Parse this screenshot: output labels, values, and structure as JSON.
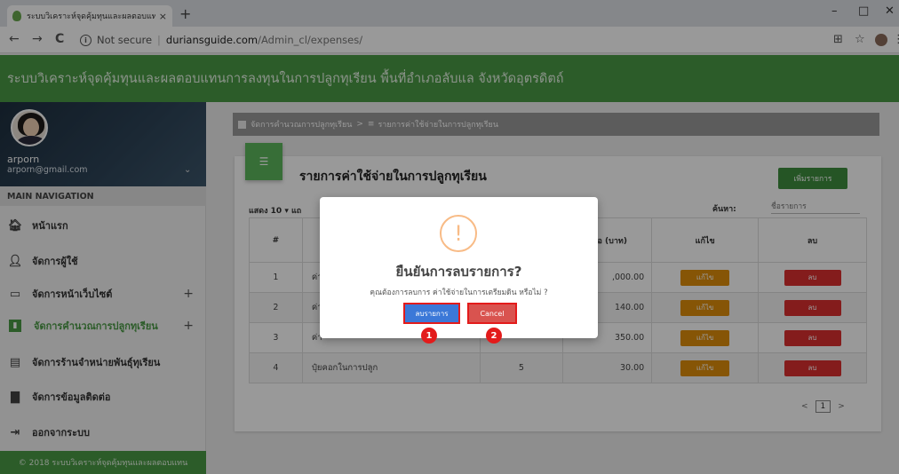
{
  "browser": {
    "tab_title": "ระบบวิเคราะห์จุดคุ้มทุนและผลตอบแทนก",
    "tab_close": "×",
    "new_tab": "+",
    "back": "←",
    "forward": "→",
    "reload": "C",
    "security_label": "Not secure",
    "host": "duriansguide.com",
    "path": "/Admin_cl/expenses/",
    "minimize": "–",
    "maximize": "□",
    "close": "✕"
  },
  "app": {
    "title": "ระบบวิเคราะห์จุดคุ้มทุนและผลตอบแทนการลงทุนในการปลูกทุเรียน พื้นที่อำเภอลับแล จังหวัดอุตรดิตถ์"
  },
  "sidebar": {
    "user_name": "arporn",
    "user_email": "arporn@gmail.com",
    "nav_header": "MAIN NAVIGATION",
    "items": [
      {
        "label": "หน้าแรก",
        "icon": "home-icon"
      },
      {
        "label": "จัดการผู้ใช้",
        "icon": "user-icon"
      },
      {
        "label": "จัดการหน้าเว็บไซต์",
        "icon": "window-icon",
        "expandable": true
      },
      {
        "label": "จัดการคำนวณการปลูกทุเรียน",
        "icon": "chart-icon",
        "expandable": true
      },
      {
        "label": "จัดการร้านจำหน่ายพันธุ์ทุเรียน",
        "icon": "store-icon"
      },
      {
        "label": "จัดการข้อมูลติดต่อ",
        "icon": "message-icon"
      },
      {
        "label": "ออกจากระบบ",
        "icon": "logout-icon"
      }
    ],
    "footer": "© 2018 ระบบวิเคราะห์จุดคุ้มทุนและผลตอบแทน"
  },
  "breadcrumb": {
    "parent": "จัดการคำนวณการปลูกทุเรียน",
    "separator": ">",
    "current": "รายการค่าใช้จ่ายในการปลูกทุเรียน"
  },
  "card": {
    "title": "รายการค่าใช้จ่ายในการปลูกทุเรียน",
    "add_button": "เพิ่มรายการ",
    "length_label": "แสดง 10 ▾ แถ",
    "search_label": "ค้นหา:",
    "search_placeholder": "ชื่อรายการ",
    "columns": [
      "#",
      "",
      "",
      "าต่อ (บาท)",
      "แก้ไข",
      "ลบ"
    ],
    "rows": [
      {
        "no": "1",
        "name": "ค่า",
        "qty": "",
        "price": ",000.00",
        "edit": "แก้ไข",
        "del": "ลบ"
      },
      {
        "no": "2",
        "name": "ค่า",
        "qty": "",
        "price": "140.00",
        "edit": "แก้ไข",
        "del": "ลบ"
      },
      {
        "no": "3",
        "name": "ค่า",
        "qty": "",
        "price": "350.00",
        "edit": "แก้ไข",
        "del": "ลบ"
      },
      {
        "no": "4",
        "name": "ปุ๋ยคอกในการปลูก",
        "qty": "5",
        "price": "30.00",
        "edit": "แก้ไข",
        "del": "ลบ"
      }
    ],
    "pager": {
      "prev": "<",
      "page": "1",
      "next": ">"
    }
  },
  "modal": {
    "icon": "!",
    "title": "ยืนยันการลบรายการ?",
    "text": "คุณต้องการลบการ ค่าใช้จ่ายในการเตรียมดิน หรือไม่ ?",
    "confirm": "ลบรายการ",
    "cancel": "Cancel",
    "markers": [
      "1",
      "2"
    ]
  }
}
